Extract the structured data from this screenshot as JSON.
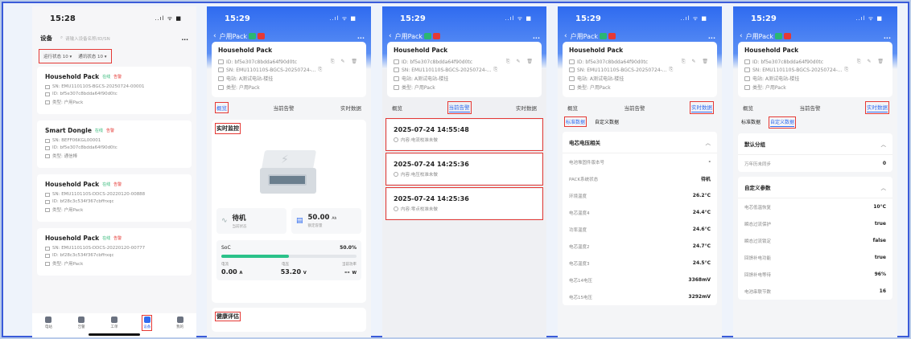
{
  "colors": {
    "accent": "#2f6bf0",
    "highlight_box": "#e53935",
    "online": "#2bb673",
    "alarm": "#e53935"
  },
  "phone1": {
    "time": "15:28",
    "status_icons": "..ıl ᯤ ■",
    "header_title": "设备",
    "search_placeholder": "请输入设备名称/ID/SN",
    "more": "...",
    "filters": [
      "运行状态 10 ▾",
      "通讯状态 10 ▾"
    ],
    "devices": [
      {
        "name": "Household Pack",
        "online": "在线",
        "alarm": "告警",
        "lines": [
          "SN: EMU110110S-BGCS-20250724-00001",
          "ID: bf5e307c8bdda64f90d0tc",
          "类型: 户用Pack"
        ]
      },
      {
        "name": "Smart Dongle",
        "online": "在线",
        "alarm": "告警",
        "lines": [
          "SN: BEFF06KGL00001",
          "ID: bf5e307c8bdda64f90d0tc",
          "类型: 通信棒"
        ]
      },
      {
        "name": "Household Pack",
        "online": "在线",
        "alarm": "告警",
        "lines": [
          "SN: EMU110110S-DDCS-20220120-00888",
          "ID: bf28c3c534f367cbffrxqc",
          "类型: 户用Pack"
        ]
      },
      {
        "name": "Household Pack",
        "online": "在线",
        "alarm": "告警",
        "lines": [
          "SN: EMU110110S-DDCS-20220120-00777",
          "ID: bf28c3c534f367cbffrxqc",
          "类型: 户用Pack"
        ]
      }
    ],
    "tabbar": [
      "电站",
      "告警",
      "工单",
      "设备",
      "我的"
    ]
  },
  "detail": {
    "nav_title": "户用Pack",
    "more": "...",
    "card_title": "Household Pack",
    "id": "ID: bf5e307c8bdda64f90d0tc",
    "sn": "SN: EMU110110S-BGCS-20250724-...",
    "station": "电站: A测试电站-楼挂",
    "type": "类型: 户用Pack",
    "tabs": [
      "概览",
      "当前告警",
      "实时数据"
    ]
  },
  "phone2": {
    "time": "15:29",
    "section": "实时监控",
    "status_value": "待机",
    "status_label": "当前状态",
    "capacity_value": "50.00",
    "capacity_unit": "Ah",
    "capacity_label": "额定容量",
    "soc_label": "SoC",
    "soc_value": "50.0%",
    "soc_fraction": 0.5,
    "meas_labels": [
      "电流",
      "电压",
      "当前功率"
    ],
    "current": "0.00",
    "current_unit": "A",
    "voltage": "53.20",
    "voltage_unit": "V",
    "power": "--",
    "power_unit": "W",
    "health": "健康评估"
  },
  "phone3": {
    "time": "15:29",
    "alarms": [
      {
        "time": "2025-07-24 14:55:48",
        "content": "内容:电流校准未做"
      },
      {
        "time": "2025-07-24 14:25:36",
        "content": "内容:电压校准未做"
      },
      {
        "time": "2025-07-24 14:25:36",
        "content": "内容:零点校准未做"
      }
    ]
  },
  "phone4": {
    "time": "15:29",
    "subtabs": [
      "标准数据",
      "自定义数据"
    ],
    "group_title": "电芯电压相关",
    "rows": [
      {
        "k": "电池堆固件版本号",
        "v": "-"
      },
      {
        "k": "PACK系统状态",
        "v": "待机"
      },
      {
        "k": "环境温度",
        "v": "26.2°C"
      },
      {
        "k": "电芯温度4",
        "v": "24.4°C"
      },
      {
        "k": "功率温度",
        "v": "24.6°C"
      },
      {
        "k": "电芯温度2",
        "v": "24.7°C"
      },
      {
        "k": "电芯温度3",
        "v": "24.5°C"
      },
      {
        "k": "电芯14电压",
        "v": "3368mV"
      },
      {
        "k": "电芯15电压",
        "v": "3292mV"
      }
    ]
  },
  "phone5": {
    "time": "15:29",
    "subtabs": [
      "标准数据",
      "自定义数据"
    ],
    "group1_title": "默认分组",
    "group1_rows": [
      {
        "k": "万年历未同步",
        "v": "0"
      }
    ],
    "group2_title": "自定义参数",
    "group2_rows": [
      {
        "k": "电芯低温恢复",
        "v": "10°C"
      },
      {
        "k": "瞬态过流保护",
        "v": "true"
      },
      {
        "k": "瞬态过流锁定",
        "v": "false"
      },
      {
        "k": "回馈补电功能",
        "v": "true"
      },
      {
        "k": "回馈补电等待",
        "v": "96%"
      },
      {
        "k": "电池串联节数",
        "v": "16"
      }
    ]
  }
}
